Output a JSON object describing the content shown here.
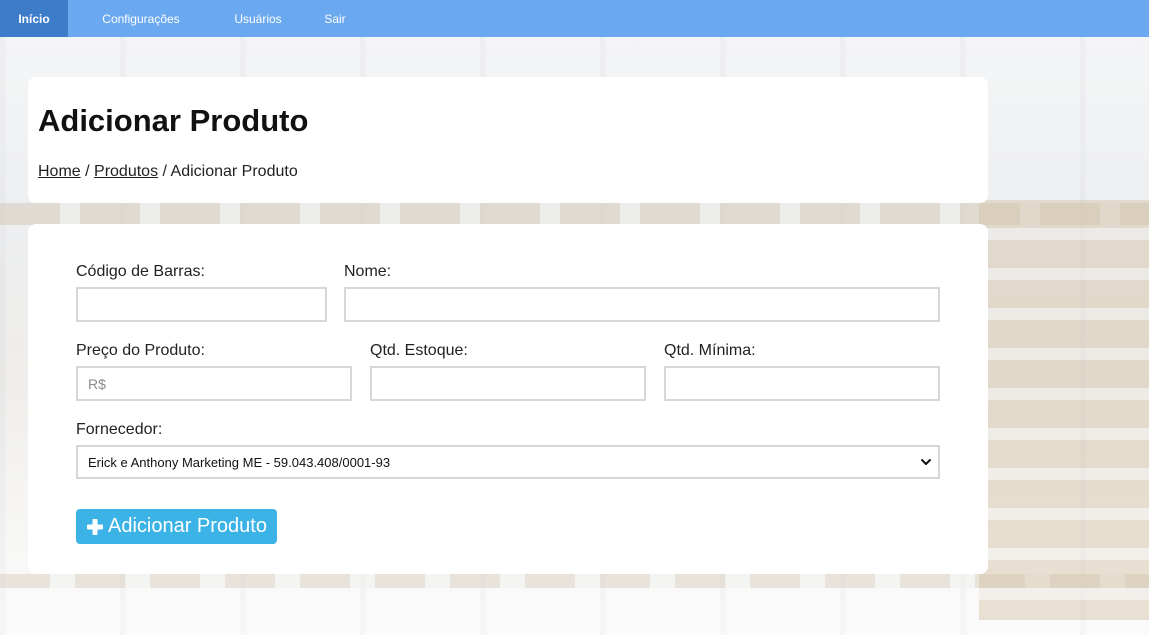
{
  "nav": {
    "items": [
      {
        "label": "Início",
        "active": true
      },
      {
        "label": "Configurações",
        "active": false
      },
      {
        "label": "Usuários",
        "active": false
      },
      {
        "label": "Sair",
        "active": false
      }
    ],
    "color": "#6aa9f0",
    "active_color": "#3d7cc9"
  },
  "header": {
    "title": "Adicionar Produto",
    "breadcrumb": {
      "home": "Home",
      "separator1": " / ",
      "products": "Produtos",
      "separator2": " / ",
      "current": "Adicionar Produto"
    }
  },
  "form": {
    "barcode": {
      "label": "Código de Barras:",
      "value": "",
      "placeholder": ""
    },
    "name": {
      "label": "Nome:",
      "value": "",
      "placeholder": ""
    },
    "price": {
      "label": "Preço do Produto:",
      "value": "",
      "placeholder": "R$"
    },
    "stock": {
      "label": "Qtd. Estoque:",
      "value": "",
      "placeholder": ""
    },
    "min_stock": {
      "label": "Qtd. Mínima:",
      "value": "",
      "placeholder": ""
    },
    "supplier": {
      "label": "Fornecedor:",
      "selected": "Erick e Anthony Marketing ME - 59.043.408/0001-93",
      "icon": "chevron-down-icon"
    },
    "submit": {
      "label": "Adicionar Produto",
      "icon": "plus-icon",
      "color": "#3bb3e6"
    }
  }
}
